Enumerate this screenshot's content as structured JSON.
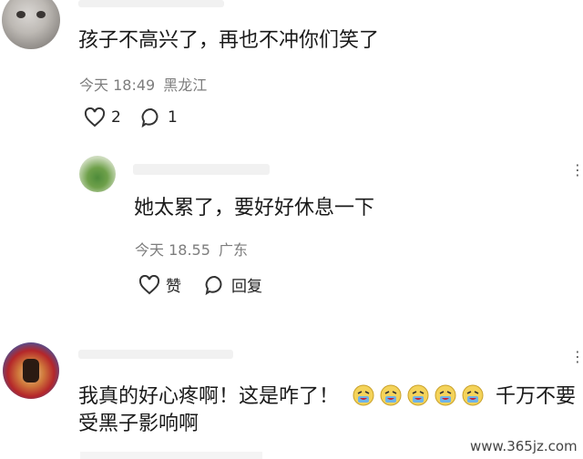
{
  "comments": [
    {
      "text": "孩子不高兴了，再也不冲你们笑了",
      "time": "今天 18:49",
      "location": "黑龙江",
      "likes": "2",
      "replies": "1"
    },
    {
      "text": "她太累了，要好好休息一下",
      "time": "今天 18.55",
      "location": "广东",
      "like_label": "赞",
      "reply_label": "回复"
    },
    {
      "text_line1_a": "我真的好心疼啊！这是咋了！",
      "emoji_count": 5,
      "text_line1_b": "千万不要",
      "text_line2": "受黑子影响啊"
    }
  ],
  "watermark": "www.365jz.com",
  "icons": [
    "heart-icon",
    "comment-icon",
    "more-vertical-icon",
    "crying-emoji-icon"
  ]
}
